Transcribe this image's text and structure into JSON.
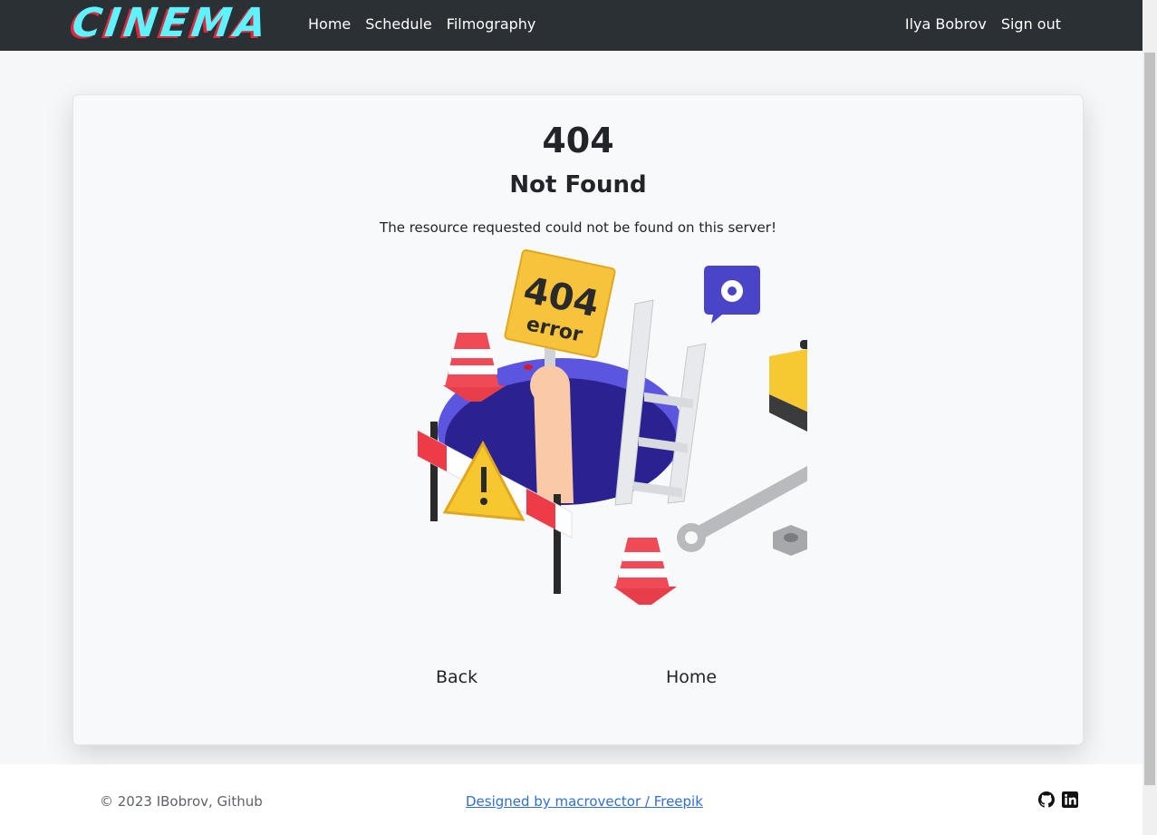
{
  "navbar": {
    "brand": "CINEMA",
    "links": [
      "Home",
      "Schedule",
      "Filmography"
    ],
    "user": "Ilya Bobrov",
    "signout": "Sign out"
  },
  "error": {
    "code": "404",
    "title": "Not Found",
    "message": "The resource requested could not be found on this server!"
  },
  "illustration": {
    "sign_number": "404",
    "sign_text": "error"
  },
  "actions": {
    "back": "Back",
    "home": "Home"
  },
  "footer": {
    "copyright": "© 2023 IBobrov, Github",
    "credit": "Designed by macrovector / Freepik",
    "icons": [
      "github-icon",
      "linkedin-icon"
    ]
  },
  "colors": {
    "navbar": "#2b3035",
    "brand": "#5ff2ff",
    "brand_shadow": "#e0283c",
    "link": "#2f6fd6"
  }
}
